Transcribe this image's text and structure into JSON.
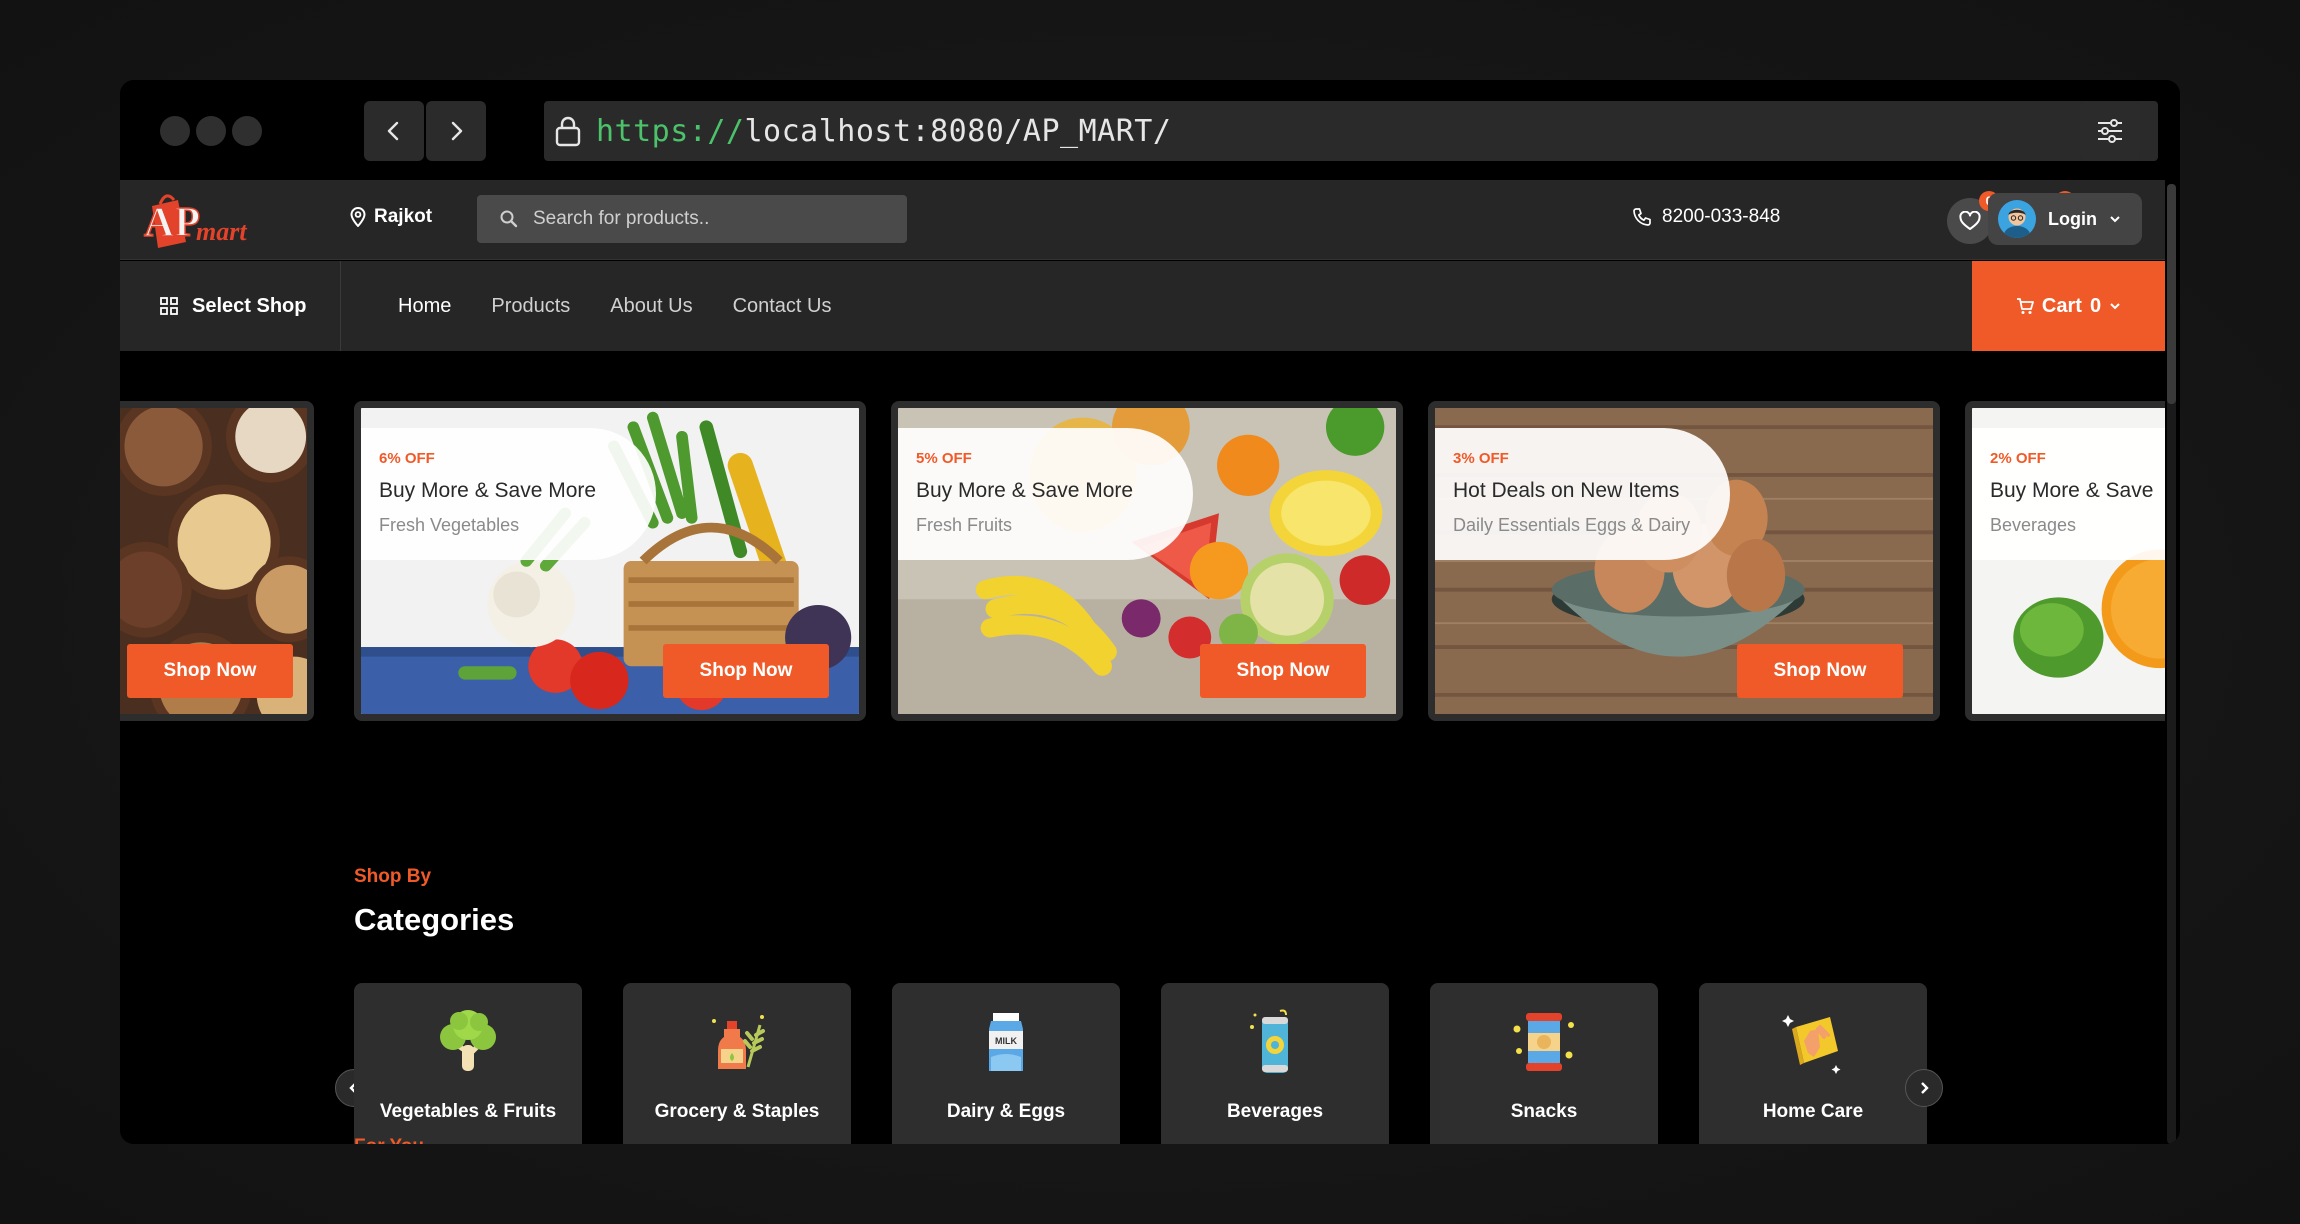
{
  "browser": {
    "url_protocol": "https://",
    "url_rest": "localhost:8080/AP_MART/",
    "icons": [
      "back-icon",
      "forward-icon",
      "lock-icon",
      "settings-sliders-icon"
    ]
  },
  "header": {
    "logo_text_a": "AP",
    "logo_text_b": "mart",
    "location": "Rajkot",
    "search_placeholder": "Search for products..",
    "phone": "8200-033-848",
    "wishlist_count": "0",
    "compare_count": "0",
    "login_label": "Login"
  },
  "nav": {
    "select_shop": "Select Shop",
    "links": [
      "Home",
      "Products",
      "About Us",
      "Contact Us"
    ],
    "active": "Home",
    "cart_label": "Cart",
    "cart_count": "0"
  },
  "banners": [
    {
      "off": "",
      "title": "",
      "subtitle": "",
      "button": "Shop Now"
    },
    {
      "off": "6% OFF",
      "title": "Buy More & Save More",
      "subtitle": "Fresh Vegetables",
      "button": "Shop Now"
    },
    {
      "off": "5% OFF",
      "title": "Buy More & Save More",
      "subtitle": "Fresh Fruits",
      "button": "Shop Now"
    },
    {
      "off": "3% OFF",
      "title": "Hot Deals on New Items",
      "subtitle": "Daily Essentials Eggs & Dairy",
      "button": "Shop Now"
    },
    {
      "off": "2% OFF",
      "title": "Buy More & Save",
      "subtitle": "Beverages",
      "button": ""
    }
  ],
  "categories_section": {
    "eyebrow": "Shop By",
    "title": "Categories",
    "items": [
      {
        "label": "Vegetables & Fruits",
        "icon": "broccoli-icon"
      },
      {
        "label": "Grocery & Staples",
        "icon": "oil-bottle-wheat-icon"
      },
      {
        "label": "Dairy & Eggs",
        "icon": "milk-carton-icon"
      },
      {
        "label": "Beverages",
        "icon": "soda-can-icon"
      },
      {
        "label": "Snacks",
        "icon": "snack-jar-icon"
      },
      {
        "label": "Home Care",
        "icon": "cleaning-sponge-icon"
      }
    ]
  },
  "next_section_eyebrow": "For You",
  "colors": {
    "accent": "#f05a28",
    "panel": "#262626",
    "card": "#2e2e2e",
    "url_protocol": "#4cc26a"
  }
}
